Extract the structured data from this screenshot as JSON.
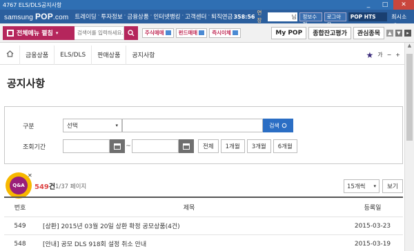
{
  "window": {
    "title": "4767 ELS/DLS공지사항",
    "controls": {
      "minimize": "_",
      "maximize": "□",
      "close": "✕"
    }
  },
  "topnav": {
    "logo_prefix": "samsung ",
    "logo_main": "POP",
    "logo_suffix": ".com",
    "links": [
      "트레이딩",
      "투자정보",
      "금융상품",
      "인터넷뱅킹",
      "고객센터",
      "퇴직연금"
    ],
    "clock": "358:56",
    "delay": "연장",
    "user_suffix": "님",
    "info_edit": "정보수정",
    "logout": "로그아웃",
    "pop_hts": "POP HTS Web",
    "minimize": "최시소개"
  },
  "subbar": {
    "menu_label": "전체메뉴 펼침",
    "search_placeholder": "검색어를 입력하세요.",
    "quick": [
      "주식매매",
      "펀드매매",
      "즉시이체"
    ],
    "tabs": [
      "My POP",
      "종합잔고평가",
      "관심종목"
    ],
    "tab_controls": [
      "▲",
      "▼",
      "▸"
    ],
    "icons": {
      "menu": "grid-icon",
      "dropdown": "▾",
      "search": "search-icon",
      "quick": "chart-icon"
    }
  },
  "breadcrumb": {
    "items": [
      "금융상품",
      "ELS/DLS",
      "판매상품",
      "공지사항"
    ],
    "font_label": "가",
    "font_minus": "−",
    "font_plus": "+",
    "icons": {
      "home": "home-icon",
      "star": "★"
    }
  },
  "page": {
    "title": "공지사항"
  },
  "filter": {
    "category_label": "구분",
    "category_value": "선택",
    "search_button": "검색",
    "search_value": "",
    "period_label": "조회기간",
    "date_from": "",
    "date_to": "",
    "tilde": "~",
    "periods": [
      "전체",
      "1개월",
      "3개월",
      "6개월"
    ],
    "icons": {
      "caret": "▾",
      "calendar": "calendar-icon"
    }
  },
  "list": {
    "qa_label": "Q&A",
    "qa_close": "✕",
    "total": "549",
    "total_unit": "건",
    "page_info": "1/37 페이지",
    "per_page": "15개씩",
    "view_button": "보기",
    "columns": [
      "번호",
      "제목",
      "등록일"
    ],
    "rows": [
      {
        "no": "549",
        "title": "[상환] 2015년 03월 20일 상환 확정 공모상품(4건)",
        "date": "2015-03-23"
      },
      {
        "no": "548",
        "title": "[안내] 공모 DLS 918회 설정 취소 안내",
        "date": "2015-03-19"
      }
    ]
  },
  "colors": {
    "titlebar": "#2f6fb3",
    "topnav": "#2b5f9e",
    "brand": "#b5265c",
    "search_button": "#2b6ec4",
    "qa_outer": "#f7b800",
    "qa_inner": "#9a1f7a",
    "count_highlight": "#d44444"
  }
}
